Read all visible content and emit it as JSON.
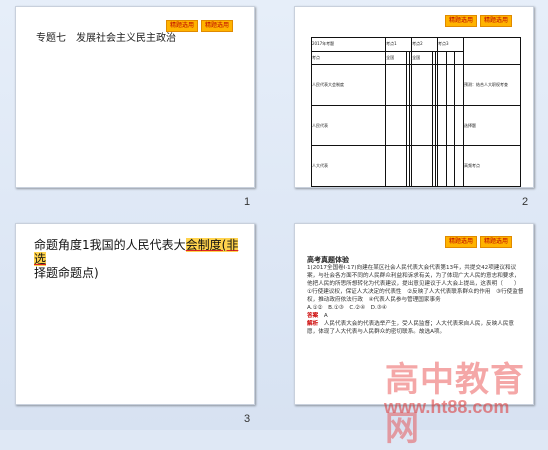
{
  "slides": [
    {
      "number": "1",
      "tags": [
        "精题选用",
        "精题选用"
      ],
      "title": "专题七　发展社会主义民主政治"
    },
    {
      "number": "2",
      "tags": [
        "精题选用",
        "精题选用"
      ],
      "table": {
        "header": [
          "2017年考题",
          "考点1",
          "考点2",
          "考点3"
        ],
        "rows": [
          [
            "考点",
            "全国",
            "全国",
            "近年考向"
          ],
          [
            "人民代表大会制度",
            "",
            "",
            "预测：结合人大职权考查"
          ],
          [
            "人民代表",
            "",
            "",
            "选择题"
          ],
          [
            "人大代表",
            "",
            "",
            "高频考点"
          ]
        ]
      }
    },
    {
      "number": "3",
      "heading_plain": "命题角度1我国的人民代表大",
      "heading_highlight": "会制度(非选",
      "heading_rest": "择题命题点)"
    },
    {
      "number": "4",
      "tags": [
        "精题选用",
        "精题选用"
      ],
      "section": "高考真题体验",
      "question": "1(2017全国卷I·17)向建在某区社会人民代表大会代表第13年，共提交42项建议和议案，与社会各方面不同的人民群众利益和诉求有关，为了体现广大人民的意志和要求，他把人民的所思所想转化为代表建议，提出意见建议于人大会上提出，这表明（　　）",
      "options": "①行使建议权，保证人大决定的代表性　②反映了人大代表联系群众的作用　③行使监督权，推动政府依法行政　④代表人民参与管理国家事务",
      "choices": "A.①②　B.①③　C.②④　D.③④",
      "answer_label": "答案",
      "answer": "A",
      "explain_label": "解析",
      "explanation": "人民代表大会的代表选举产生，受人民监督；人大代表来自人民，反映人民意愿，体现了人大代表与人民群众的密切联系。故选A项。"
    }
  ],
  "watermark": {
    "main": "高中教育网",
    "url": "www.ht88.com"
  }
}
